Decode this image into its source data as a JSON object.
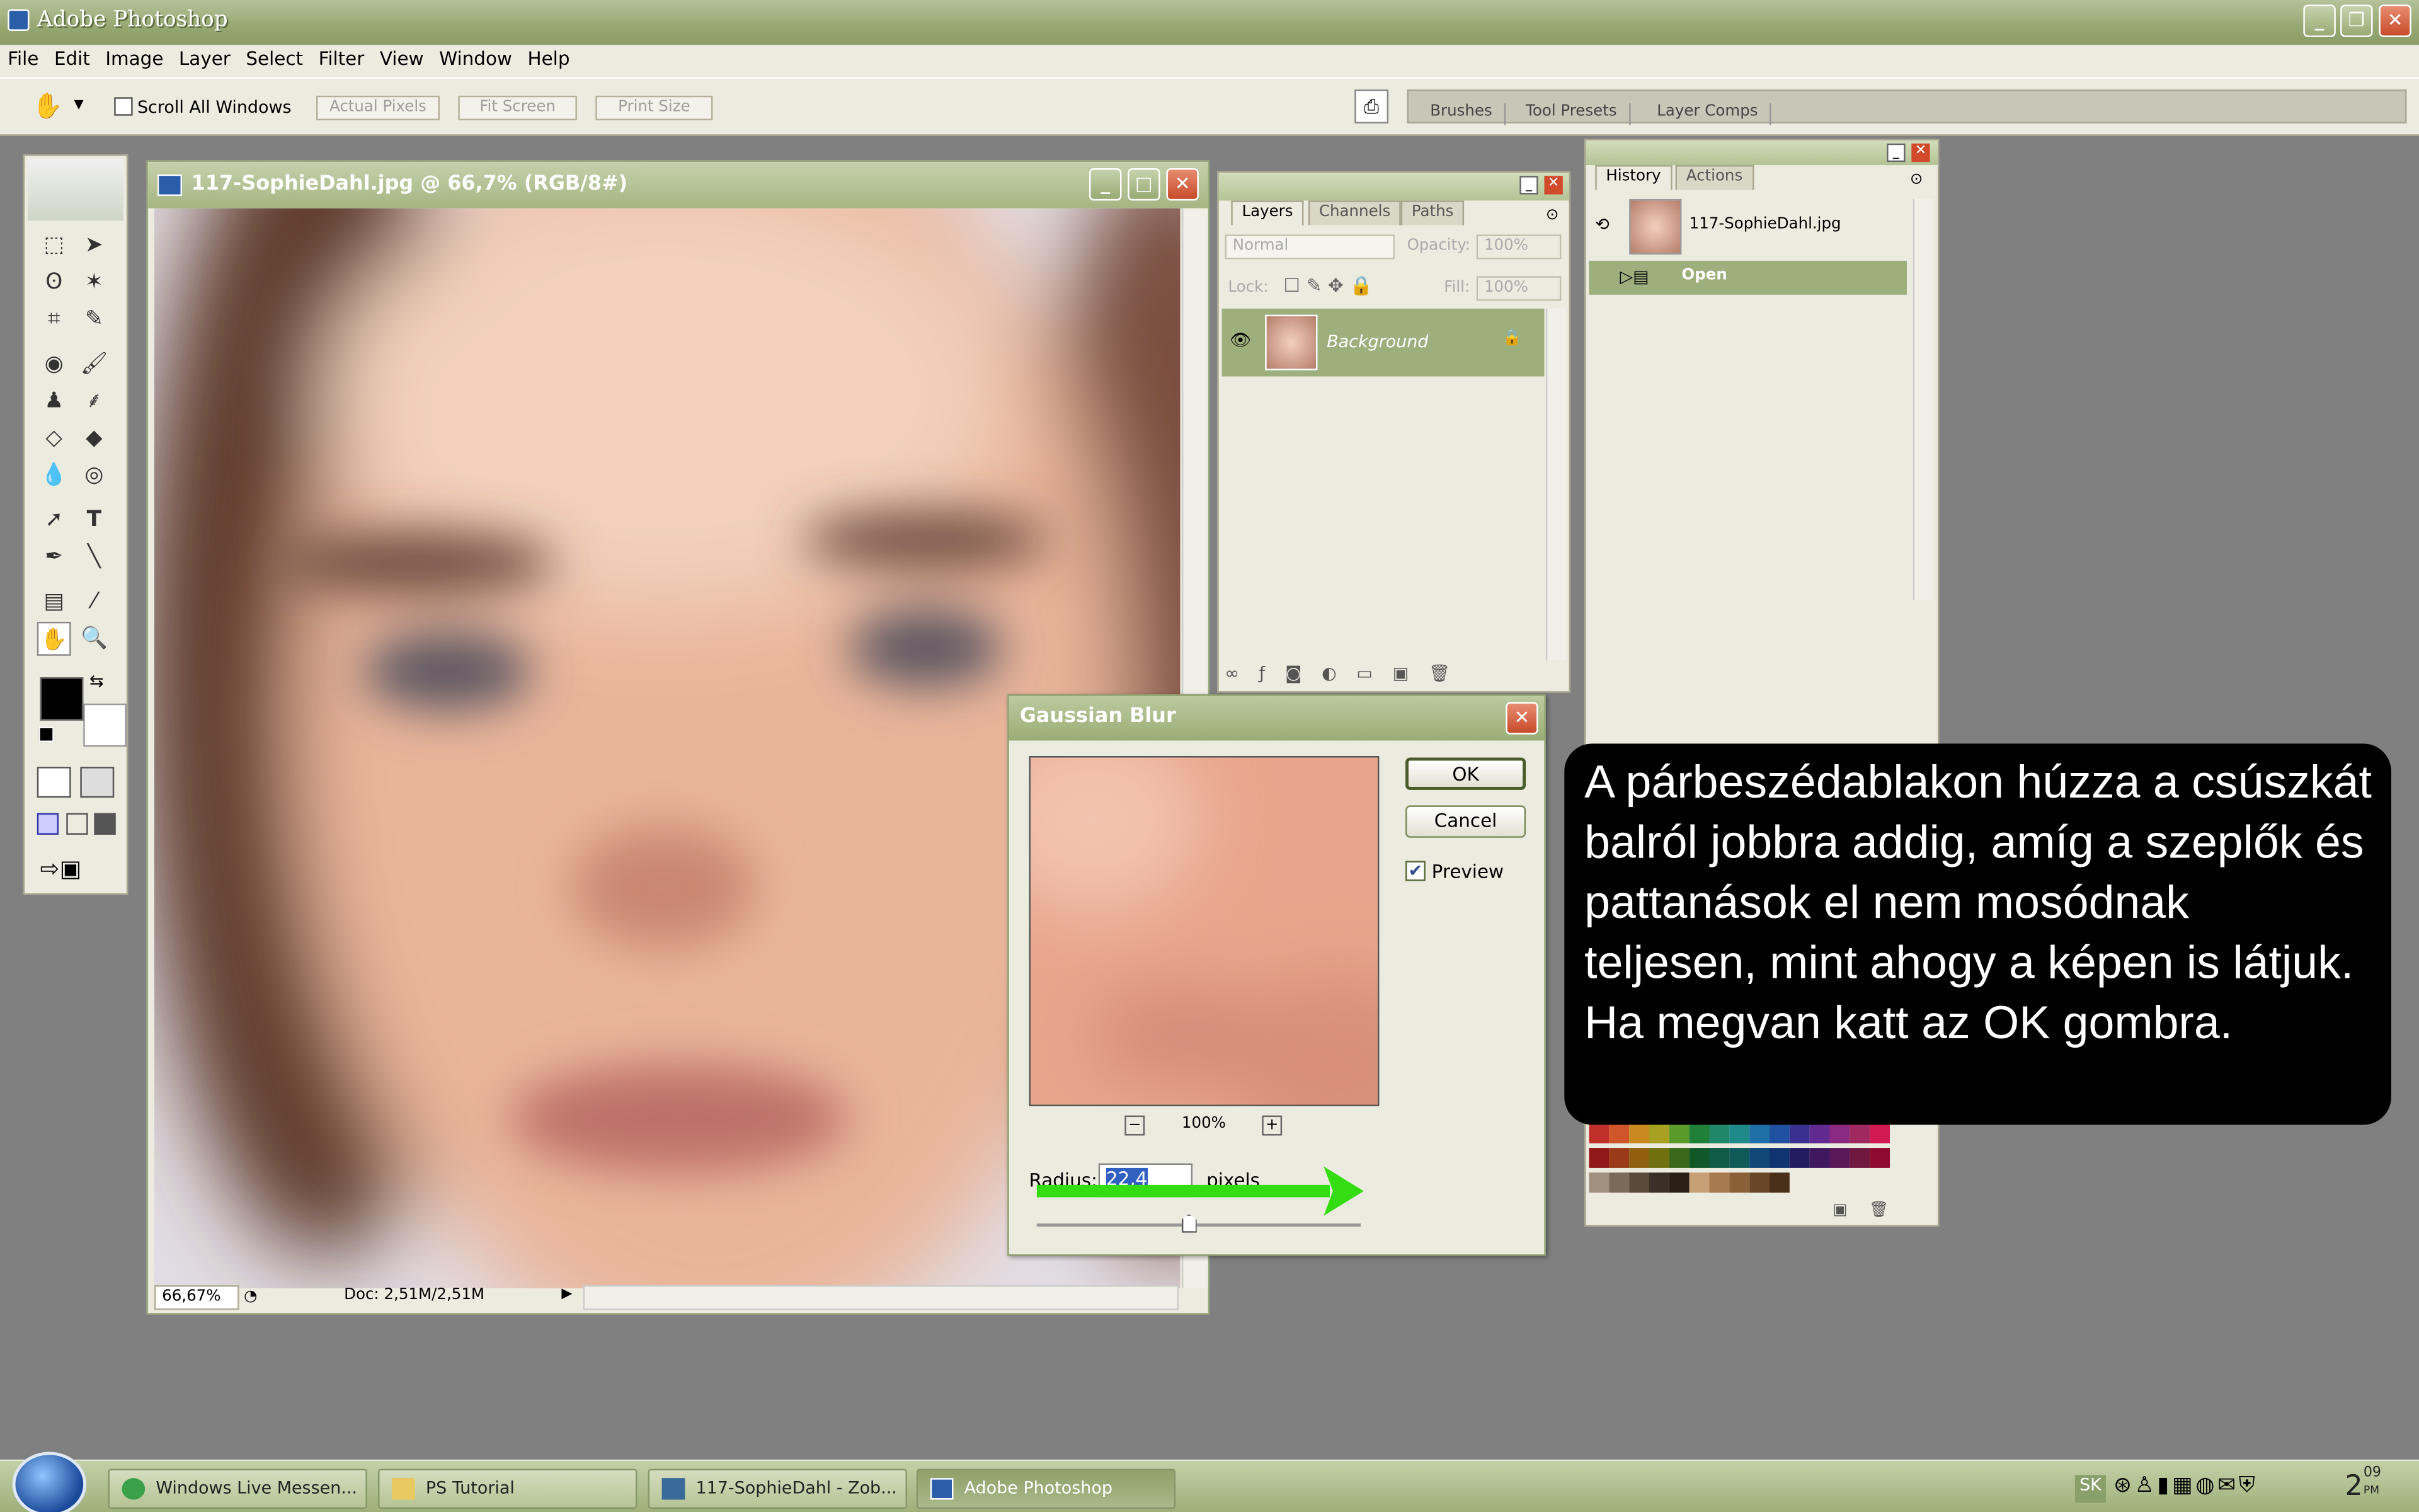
{
  "app": {
    "title": "Adobe Photoshop"
  },
  "menu": [
    "File",
    "Edit",
    "Image",
    "Layer",
    "Select",
    "Filter",
    "View",
    "Window",
    "Help"
  ],
  "options": {
    "scroll_all": "Scroll All Windows",
    "actual_pixels": "Actual Pixels",
    "fit_screen": "Fit Screen",
    "print_size": "Print Size"
  },
  "palette_well": {
    "tabs": [
      "Brushes",
      "Tool Presets",
      "Layer Comps"
    ]
  },
  "document": {
    "title": "117-SophieDahl.jpg @ 66,7% (RGB/8#)",
    "zoom": "66,67%",
    "doc_info": "Doc: 2,51M/2,51M"
  },
  "layers": {
    "tabs": [
      "Layers",
      "Channels",
      "Paths"
    ],
    "blend_mode": "Normal",
    "opacity_label": "Opacity:",
    "opacity": "100%",
    "lock_label": "Lock:",
    "fill_label": "Fill:",
    "fill": "100%",
    "items": [
      {
        "name": "Background"
      }
    ]
  },
  "history": {
    "tabs": [
      "History",
      "Actions"
    ],
    "snapshot": "117-SophieDahl.jpg",
    "steps": [
      "Open"
    ]
  },
  "dialog": {
    "title": "Gaussian Blur",
    "ok": "OK",
    "cancel": "Cancel",
    "preview_label": "Preview",
    "preview_checked": true,
    "zoom": "100%",
    "radius_label": "Radius:",
    "radius_value": "22,4",
    "unit": "pixels",
    "slider_fraction": 0.47
  },
  "callout": {
    "text": "A párbeszédablakon húzza a csúszkát balról jobbra addig, amíg a szeplők és pattanások el nem mosódnak teljesen, mint ahogy a képen is látjuk. Ha megvan katt az OK gombra."
  },
  "taskbar": {
    "items": [
      "Windows Live Messen...",
      "PS Tutorial",
      "117-SophieDahl - Zob...",
      "Adobe Photoshop"
    ],
    "tray_lang": "SK",
    "clock": "2",
    "clock_min": "09",
    "clock_pm": "PM"
  },
  "colors": {
    "accent": "#96a872",
    "callout_bg": "#000000",
    "arrow": "#33dd11"
  }
}
